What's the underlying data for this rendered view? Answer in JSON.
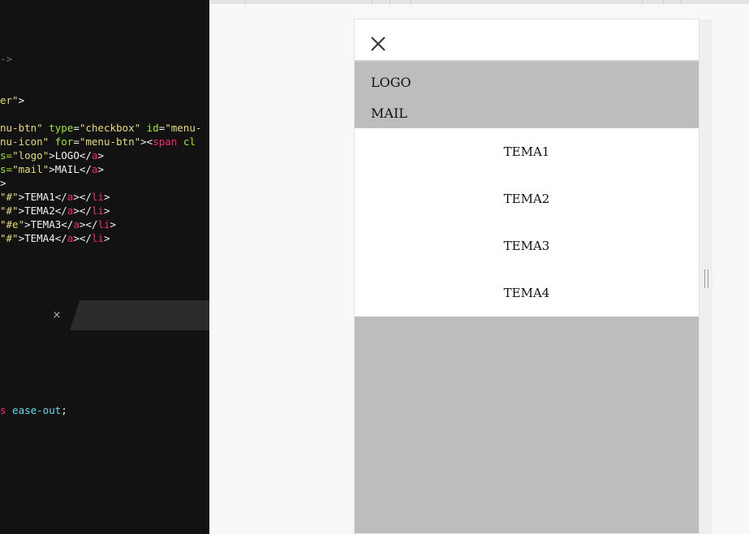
{
  "editor": {
    "lines": [
      [
        {
          "t": "->",
          "c": "grey"
        }
      ],
      [
        {
          "t": "er\"",
          "c": "yellow"
        },
        {
          "t": ">",
          "c": "white"
        }
      ],
      [
        {
          "t": "nu-btn\"",
          "c": "yellow"
        },
        {
          "t": " type",
          "c": "green"
        },
        {
          "t": "=",
          "c": "white"
        },
        {
          "t": "\"checkbox\"",
          "c": "yellow"
        },
        {
          "t": " id",
          "c": "green"
        },
        {
          "t": "=",
          "c": "white"
        },
        {
          "t": "\"menu-",
          "c": "yellow"
        }
      ],
      [
        {
          "t": "nu-icon\"",
          "c": "yellow"
        },
        {
          "t": " for",
          "c": "green"
        },
        {
          "t": "=",
          "c": "white"
        },
        {
          "t": "\"menu-btn\"",
          "c": "yellow"
        },
        {
          "t": "><",
          "c": "white"
        },
        {
          "t": "span",
          "c": "pink"
        },
        {
          "t": " cl",
          "c": "green"
        }
      ],
      [
        {
          "t": "s=",
          "c": "green"
        },
        {
          "t": "\"logo\"",
          "c": "yellow"
        },
        {
          "t": ">LOGO</",
          "c": "white"
        },
        {
          "t": "a",
          "c": "pink"
        },
        {
          "t": ">",
          "c": "white"
        }
      ],
      [
        {
          "t": "s=",
          "c": "green"
        },
        {
          "t": "\"mail\"",
          "c": "yellow"
        },
        {
          "t": ">MAIL</",
          "c": "white"
        },
        {
          "t": "a",
          "c": "pink"
        },
        {
          "t": ">",
          "c": "white"
        }
      ],
      [
        {
          "t": ">",
          "c": "white"
        }
      ],
      [
        {
          "t": "\"#\"",
          "c": "yellow"
        },
        {
          "t": ">TEMA1</",
          "c": "white"
        },
        {
          "t": "a",
          "c": "pink"
        },
        {
          "t": "></",
          "c": "white"
        },
        {
          "t": "li",
          "c": "pink"
        },
        {
          "t": ">",
          "c": "white"
        }
      ],
      [
        {
          "t": "\"#\"",
          "c": "yellow"
        },
        {
          "t": ">TEMA2</",
          "c": "white"
        },
        {
          "t": "a",
          "c": "pink"
        },
        {
          "t": "></",
          "c": "white"
        },
        {
          "t": "li",
          "c": "pink"
        },
        {
          "t": ">",
          "c": "white"
        }
      ],
      [
        {
          "t": "\"#e\"",
          "c": "yellow"
        },
        {
          "t": ">TEMA3</",
          "c": "white"
        },
        {
          "t": "a",
          "c": "pink"
        },
        {
          "t": "></",
          "c": "white"
        },
        {
          "t": "li",
          "c": "pink"
        },
        {
          "t": ">",
          "c": "white"
        }
      ],
      [
        {
          "t": "\"#\"",
          "c": "yellow"
        },
        {
          "t": ">TEMA4</",
          "c": "white"
        },
        {
          "t": "a",
          "c": "pink"
        },
        {
          "t": "></",
          "c": "white"
        },
        {
          "t": "li",
          "c": "pink"
        },
        {
          "t": ">",
          "c": "white"
        }
      ],
      [
        {
          "t": "s",
          "c": "pink"
        },
        {
          "t": " ease-out",
          "c": "blue"
        },
        {
          "t": ";",
          "c": "white"
        }
      ]
    ],
    "tab_close_glyph": "×"
  },
  "preview": {
    "close_icon": "close-icon",
    "brand": {
      "logo": "LOGO",
      "mail": "MAIL"
    },
    "menu_items": [
      "TEMA1",
      "TEMA2",
      "TEMA3",
      "TEMA4"
    ]
  }
}
